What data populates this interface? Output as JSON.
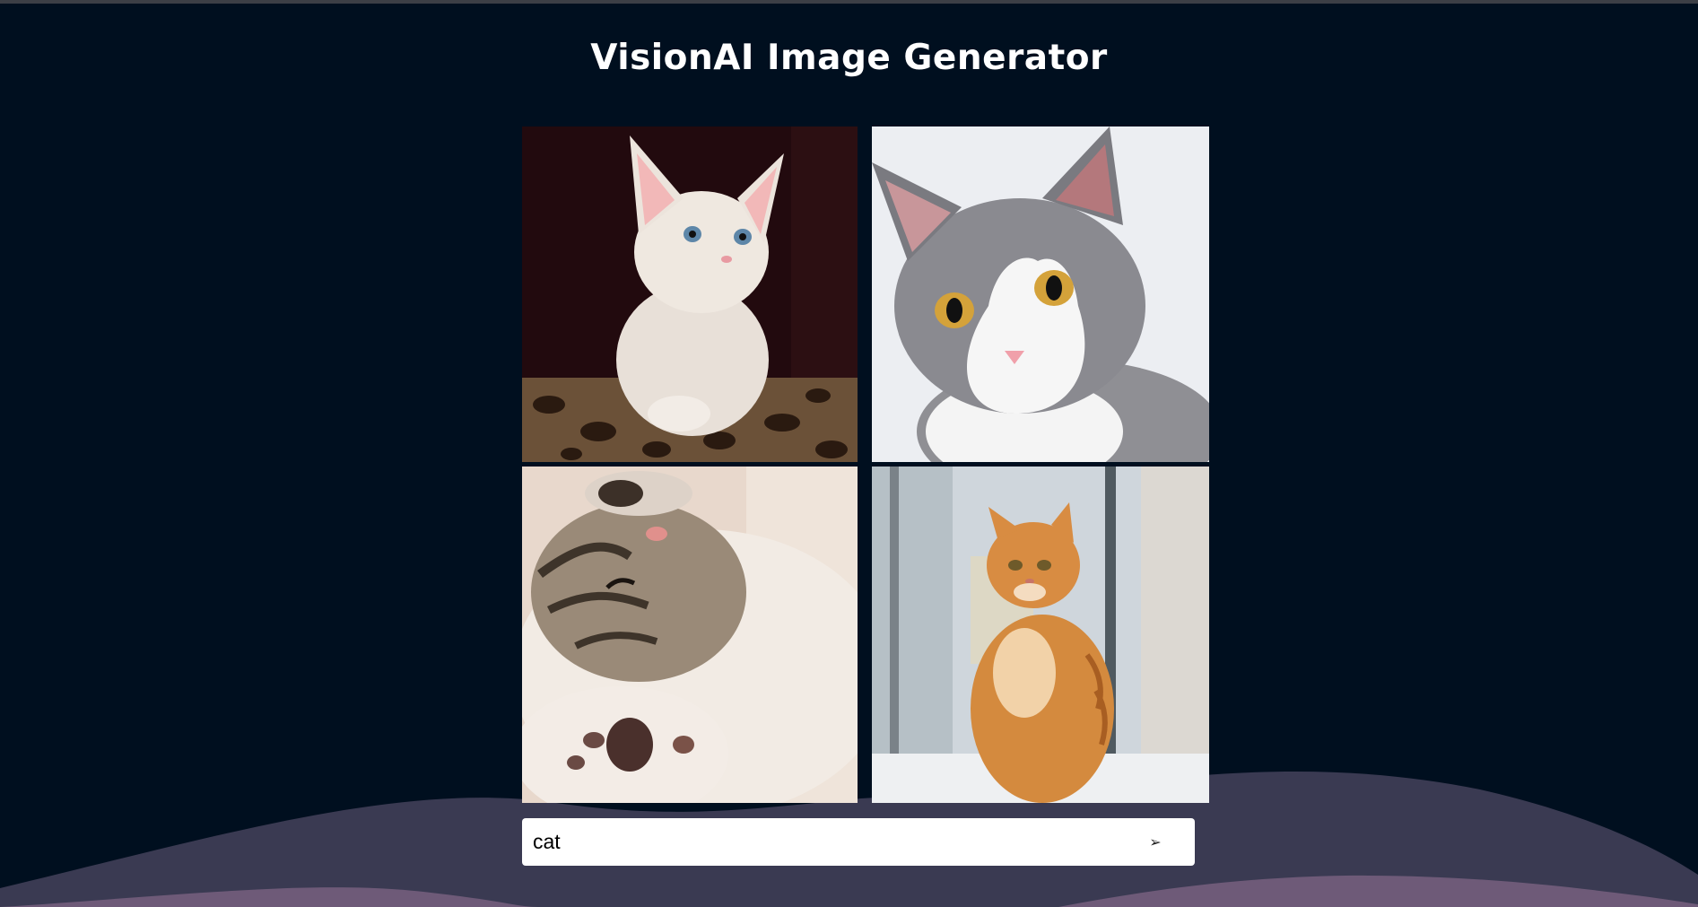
{
  "app": {
    "title": "VisionAI Image Generator"
  },
  "gallery": {
    "images": [
      {
        "subject": "white kitten on leopard print"
      },
      {
        "subject": "grey and white cat"
      },
      {
        "subject": "sleeping tabby kitten"
      },
      {
        "subject": "orange tabby cat by window"
      }
    ]
  },
  "prompt": {
    "value": "cat",
    "send_icon": "➢"
  },
  "colors": {
    "background": "#000f1f",
    "wave_back": "#3a3a52",
    "wave_front": "#6e5a78",
    "title": "#ffffff"
  }
}
